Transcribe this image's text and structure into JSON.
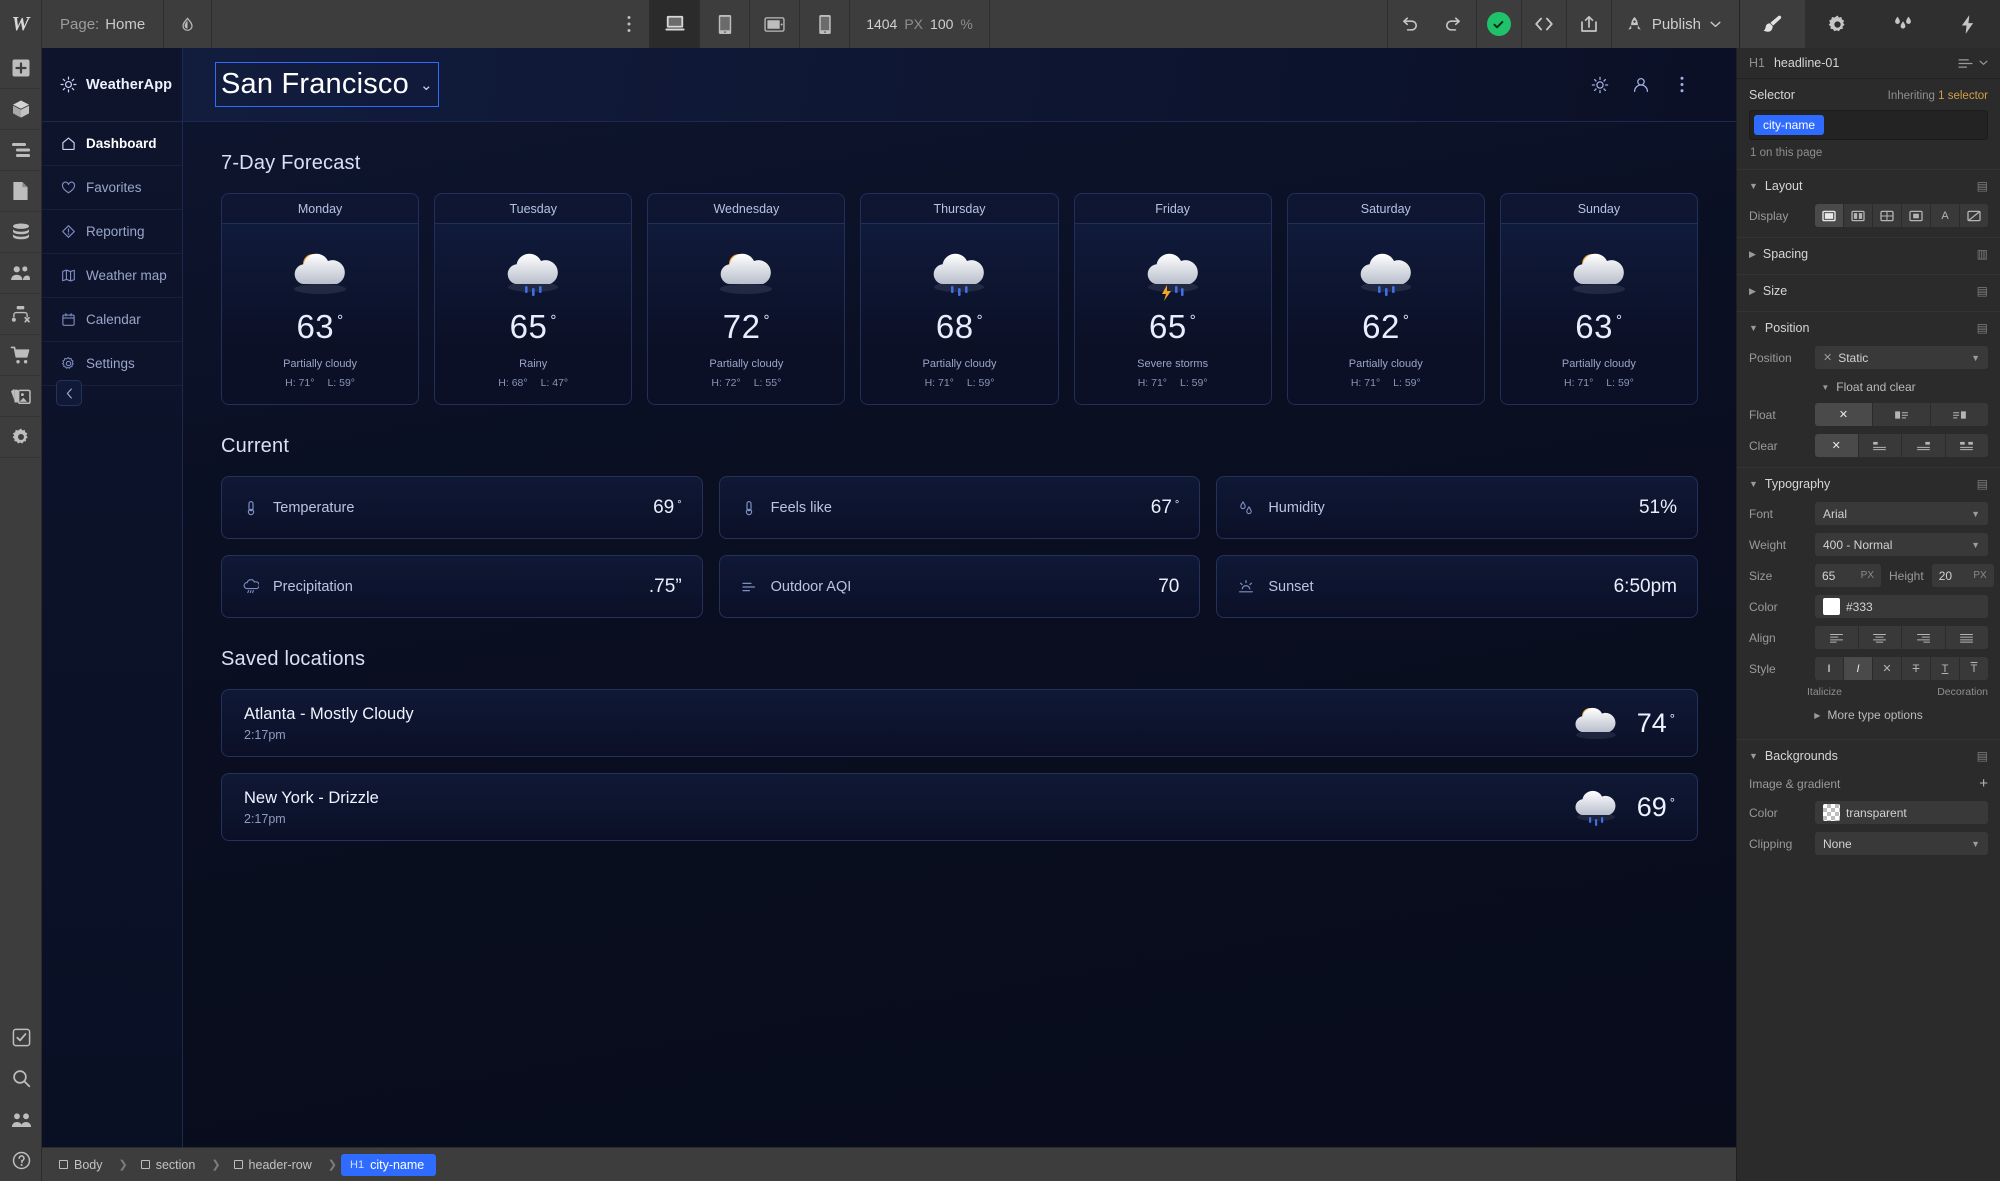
{
  "topbar": {
    "logo": "W",
    "page_label": "Page:",
    "page_name": "Home",
    "canvas_width": "1404",
    "canvas_width_unit": "PX",
    "zoom": "100",
    "zoom_unit": "%",
    "publish_label": "Publish"
  },
  "app": {
    "brand": "WeatherApp",
    "nav": [
      {
        "label": "Dashboard",
        "icon": "home-icon"
      },
      {
        "label": "Favorites",
        "icon": "heart-icon"
      },
      {
        "label": "Reporting",
        "icon": "diamond-icon"
      },
      {
        "label": "Weather map",
        "icon": "map-icon"
      },
      {
        "label": "Calendar",
        "icon": "calendar-icon"
      },
      {
        "label": "Settings",
        "icon": "gear-icon"
      }
    ],
    "city": "San Francisco",
    "forecast_title": "7-Day Forecast",
    "forecast": [
      {
        "day": "Monday",
        "temp": "63",
        "deg": "°",
        "desc": "Partially cloudy",
        "high": "H: 71°",
        "low": "L: 59°",
        "icon": "sun-cloud"
      },
      {
        "day": "Tuesday",
        "temp": "65",
        "deg": "°",
        "desc": "Rainy",
        "high": "H: 68°",
        "low": "L: 47°",
        "icon": "rain-cloud"
      },
      {
        "day": "Wednesday",
        "temp": "72",
        "deg": "°",
        "desc": "Partially cloudy",
        "high": "H: 72°",
        "low": "L: 55°",
        "icon": "sun-cloud"
      },
      {
        "day": "Thursday",
        "temp": "68",
        "deg": "°",
        "desc": "Partially cloudy",
        "high": "H: 71°",
        "low": "L: 59°",
        "icon": "rain-cloud"
      },
      {
        "day": "Friday",
        "temp": "65",
        "deg": "°",
        "desc": "Severe storms",
        "high": "H: 71°",
        "low": "L: 59°",
        "icon": "storm-cloud"
      },
      {
        "day": "Saturday",
        "temp": "62",
        "deg": "°",
        "desc": "Partially cloudy",
        "high": "H: 71°",
        "low": "L: 59°",
        "icon": "rain-cloud"
      },
      {
        "day": "Sunday",
        "temp": "63",
        "deg": "°",
        "desc": "Partially cloudy",
        "high": "H: 71°",
        "low": "L: 59°",
        "icon": "sun-cloud"
      }
    ],
    "current_title": "Current",
    "current": [
      {
        "label": "Temperature",
        "value": "69",
        "deg": "°",
        "icon": "thermometer-icon"
      },
      {
        "label": "Feels like",
        "value": "67",
        "deg": "°",
        "icon": "thermometer-icon"
      },
      {
        "label": "Humidity",
        "value": "51%",
        "deg": "",
        "icon": "humidity-icon"
      },
      {
        "label": "Precipitation",
        "value": ".75”",
        "deg": "",
        "icon": "precipitation-icon"
      },
      {
        "label": "Outdoor AQI",
        "value": "70",
        "deg": "",
        "icon": "aqi-icon"
      },
      {
        "label": "Sunset",
        "value": "6:50pm",
        "deg": "",
        "icon": "sunset-icon"
      }
    ],
    "saved_title": "Saved locations",
    "saved": [
      {
        "name": "Atlanta - Mostly Cloudy",
        "time": "2:17pm",
        "temp": "74",
        "deg": "°",
        "icon": "sun-cloud"
      },
      {
        "name": "New York - Drizzle",
        "time": "2:17pm",
        "temp": "69",
        "deg": "°",
        "icon": "rain-cloud"
      }
    ]
  },
  "breadcrumb": [
    {
      "tag": "",
      "label": "Body",
      "active": false
    },
    {
      "tag": "",
      "label": "section",
      "active": false
    },
    {
      "tag": "",
      "label": "header-row",
      "active": false
    },
    {
      "tag": "H1",
      "label": "city-name",
      "active": true
    }
  ],
  "panel": {
    "element_tag": "H1",
    "element_name": "headline-01",
    "selector_label": "Selector",
    "inheriting_prefix": "Inheriting",
    "inheriting_count": "1 selector",
    "class_chip": "city-name",
    "class_note": "1 on this page",
    "layout": {
      "title": "Layout",
      "display_label": "Display"
    },
    "spacing": {
      "title": "Spacing"
    },
    "size": {
      "title": "Size"
    },
    "position": {
      "title": "Position",
      "position_label": "Position",
      "position_value": "Static",
      "float_clear_label": "Float and clear",
      "float_label": "Float",
      "clear_label": "Clear"
    },
    "typography": {
      "title": "Typography",
      "font_label": "Font",
      "font_value": "Arial",
      "weight_label": "Weight",
      "weight_value": "400 - Normal",
      "size_label": "Size",
      "size_value": "65",
      "size_unit": "PX",
      "height_label": "Height",
      "height_value": "20",
      "height_unit": "PX",
      "color_label": "Color",
      "color_value": "#333",
      "align_label": "Align",
      "style_label": "Style",
      "italicize_label": "Italicize",
      "decoration_label": "Decoration",
      "more_options": "More type options"
    },
    "backgrounds": {
      "title": "Backgrounds",
      "image_gradient_label": "Image & gradient",
      "color_label": "Color",
      "color_value": "transparent",
      "clipping_label": "Clipping",
      "clipping_value": "None"
    }
  },
  "colors": {
    "accent": "#2f6bff",
    "green": "#1fc16b",
    "panel_bg": "#2b2b2b",
    "topbar_bg": "#3d3d3d",
    "canvas_bg": "#0b1020"
  }
}
